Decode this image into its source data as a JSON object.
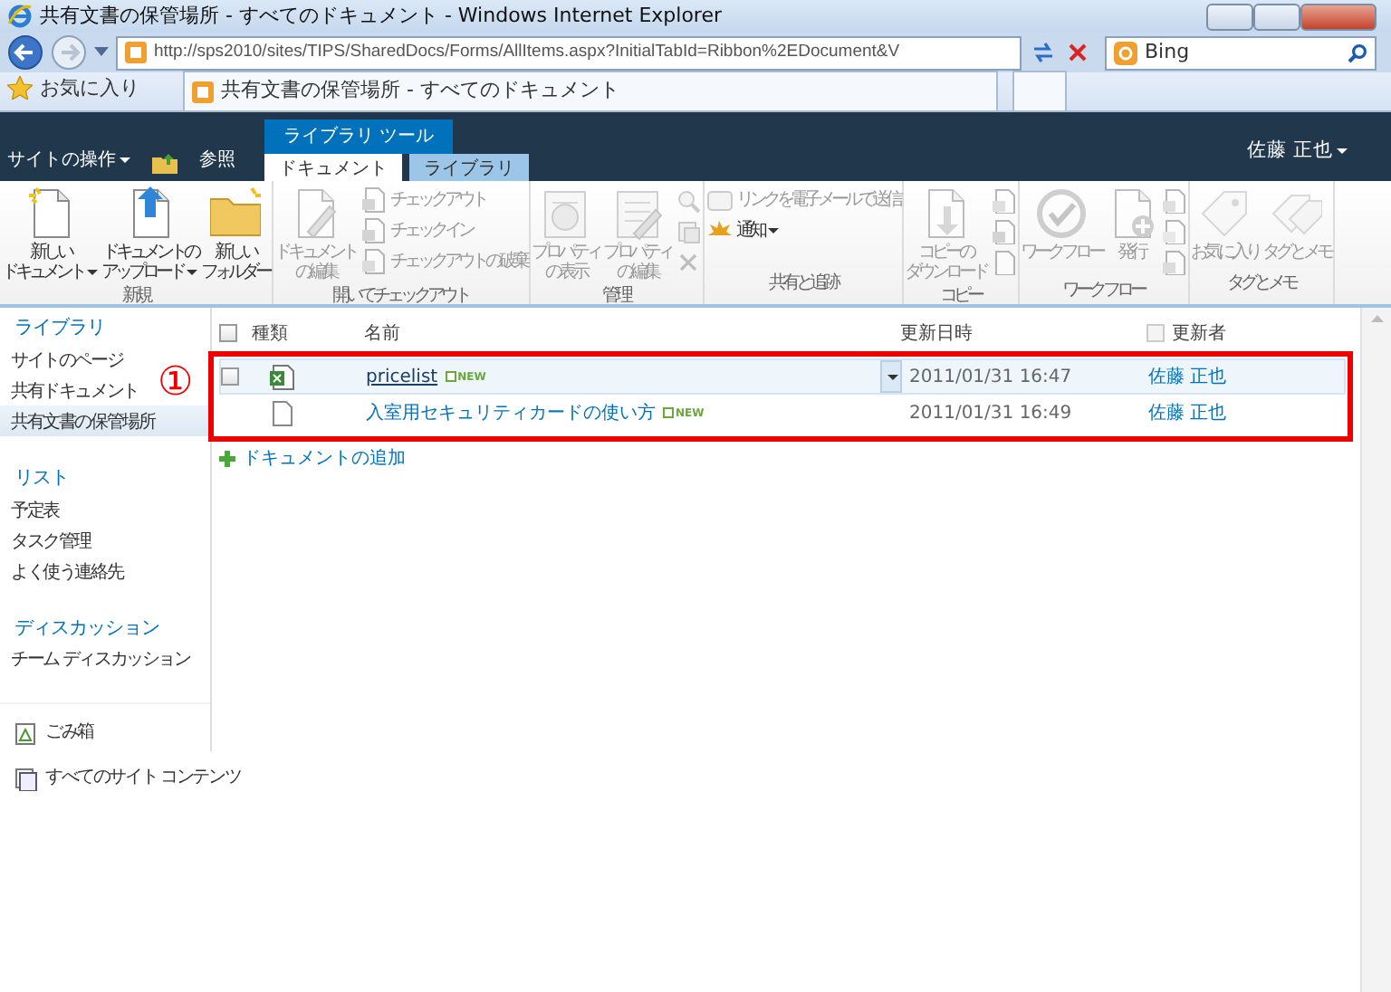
{
  "window": {
    "title": "共有文書の保管場所 - すべてのドキュメント - Windows Internet Explorer"
  },
  "address_bar": {
    "url": "http://sps2010/sites/TIPS/SharedDocs/Forms/AllItems.aspx?InitialTabId=Ribbon%2EDocument&V",
    "search_engine": "Bing"
  },
  "favorites_bar": {
    "favorites": "お気に入り",
    "tab_title": "共有文書の保管場所 - すべてのドキュメント"
  },
  "site_bar": {
    "site_actions": "サイトの操作",
    "browse": "参照",
    "tools_label": "ライブラリ ツール",
    "tabs": [
      {
        "label": "ドキュメント",
        "selected": true
      },
      {
        "label": "ライブラリ",
        "selected": false
      }
    ],
    "user": "佐藤 正也"
  },
  "ribbon": [
    {
      "label": "新規",
      "items": [
        {
          "kind": "large",
          "lines": [
            "新しい",
            "ドキュメント"
          ],
          "dropdown": true,
          "disabled": false
        },
        {
          "kind": "large",
          "lines": [
            "ドキュメントの",
            "アップロード"
          ],
          "dropdown": true,
          "disabled": false
        },
        {
          "kind": "large",
          "lines": [
            "新しい",
            "フォルダー"
          ],
          "dropdown": false,
          "disabled": false
        }
      ]
    },
    {
      "label": "開いてチェックアウト",
      "items": [
        {
          "kind": "large",
          "lines": [
            "ドキュメント",
            "の編集"
          ],
          "dropdown": false,
          "disabled": true
        },
        {
          "kind": "small",
          "label": "チェックアウト",
          "dropdown": false,
          "disabled": true
        },
        {
          "kind": "small",
          "label": "チェックイン",
          "dropdown": false,
          "disabled": true
        },
        {
          "kind": "small",
          "label": "チェックアウトの破棄",
          "dropdown": false,
          "disabled": true
        }
      ]
    },
    {
      "label": "管理",
      "items": [
        {
          "kind": "large",
          "lines": [
            "プロパティ",
            "の表示"
          ],
          "dropdown": false,
          "disabled": true
        },
        {
          "kind": "large",
          "lines": [
            "プロパティ",
            "の編集"
          ],
          "dropdown": false,
          "disabled": true
        },
        {
          "kind": "icon",
          "disabled": true
        },
        {
          "kind": "icon",
          "disabled": true
        },
        {
          "kind": "icon",
          "disabled": true
        }
      ]
    },
    {
      "label": "共有と追跡",
      "items": [
        {
          "kind": "small",
          "label": "リンクを電子メールで送信",
          "dropdown": false,
          "disabled": true
        },
        {
          "kind": "small",
          "label": "通知",
          "dropdown": true,
          "disabled": false
        }
      ]
    },
    {
      "label": "コピー",
      "items": [
        {
          "kind": "large",
          "lines": [
            "コピーの",
            "ダウンロード"
          ],
          "dropdown": false,
          "disabled": true
        },
        {
          "kind": "icon",
          "disabled": true
        },
        {
          "kind": "icon",
          "disabled": true
        },
        {
          "kind": "icon",
          "disabled": true
        }
      ]
    },
    {
      "label": "ワークフロー",
      "items": [
        {
          "kind": "large",
          "lines": [
            "ワークフロー"
          ],
          "dropdown": false,
          "disabled": true
        },
        {
          "kind": "large",
          "lines": [
            "発行"
          ],
          "dropdown": false,
          "disabled": true
        },
        {
          "kind": "icon",
          "disabled": true
        },
        {
          "kind": "icon",
          "disabled": true
        },
        {
          "kind": "icon",
          "disabled": true
        }
      ]
    },
    {
      "label": "タグとメモ",
      "items": [
        {
          "kind": "large",
          "lines": [
            "お気に入り"
          ],
          "dropdown": false,
          "disabled": true
        },
        {
          "kind": "large",
          "lines": [
            "タグとメモ"
          ],
          "dropdown": false,
          "disabled": true
        }
      ]
    }
  ],
  "sidebar": {
    "sections": [
      {
        "heading": "ライブラリ",
        "items": [
          {
            "label": "サイトのページ",
            "selected": false
          },
          {
            "label": "共有ドキュメント",
            "selected": false
          },
          {
            "label": "共有文書の保管場所",
            "selected": true
          }
        ]
      },
      {
        "heading": "リスト",
        "items": [
          {
            "label": "予定表",
            "selected": false
          },
          {
            "label": "タスク管理",
            "selected": false
          },
          {
            "label": "よく使う連絡先",
            "selected": false
          }
        ]
      },
      {
        "heading": "ディスカッション",
        "items": [
          {
            "label": "チーム ディスカッション",
            "selected": false
          }
        ]
      }
    ],
    "footer": [
      "ごみ箱",
      "すべてのサイト コンテンツ"
    ]
  },
  "table": {
    "select_all": {
      "checked": false
    },
    "columns": [
      "種類",
      "名前",
      "更新日時",
      "更新者"
    ],
    "rows": [
      {
        "kind": "spreadsheet",
        "name": "pricelist",
        "badge": "NEW",
        "modified": "2011/01/31 16:47",
        "author": "佐藤 正也",
        "selected": true,
        "checked": false
      },
      {
        "kind": "document",
        "name": "入室用セキュリティカードの使い方",
        "badge": "NEW",
        "modified": "2011/01/31 16:49",
        "author": "佐藤 正也",
        "selected": false
      }
    ]
  },
  "add_document": "ドキュメントの追加",
  "annotation": "①"
}
